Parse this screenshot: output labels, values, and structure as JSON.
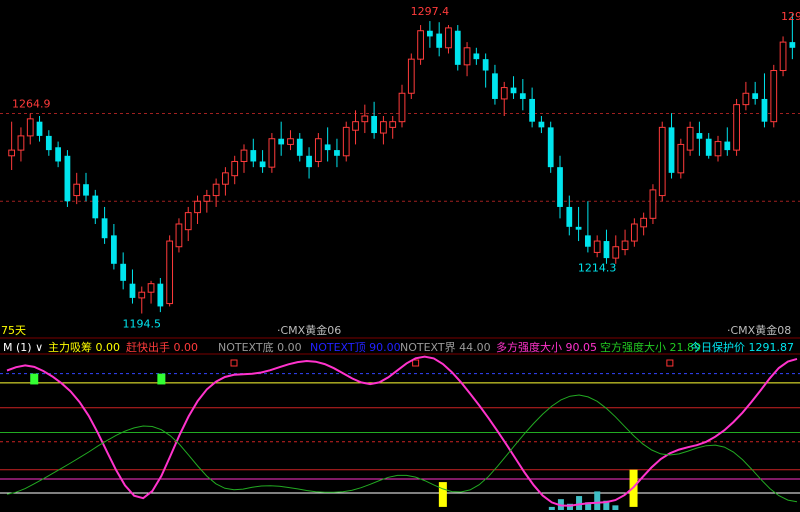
{
  "colors": {
    "background": "#000000",
    "up": "#ff3b3b",
    "down": "#00e5ee",
    "grid_dash": "#a02020",
    "pink": "#ff33cc",
    "green": "#22aa22",
    "yellow": "#ffff00",
    "bright_green": "#33ff33",
    "white": "#ffffff"
  },
  "top_labels": {
    "timeframe": "75天",
    "symbol_mid": "CMX黄金06",
    "symbol_right": "CMX黄金08"
  },
  "price_labels": {
    "high": "1297.4",
    "left_peak": "1264.9",
    "low": "1194.5",
    "mid_low": "1214.3",
    "right_edge": "129"
  },
  "indicator_header": {
    "name": "M (1)",
    "chevron": "∨",
    "items": [
      {
        "label": "主力吸筹",
        "value": "0.00",
        "color": "#ffff00"
      },
      {
        "label": "赶快出手",
        "value": "0.00",
        "color": "#ff3b3b"
      },
      {
        "label": "NOTEXT底",
        "value": "0.00",
        "color": "#999999"
      },
      {
        "label": "NOTEXT顶",
        "value": "90.00",
        "color": "#2222ff"
      },
      {
        "label": "NOTEXT界",
        "value": "44.00",
        "color": "#999999"
      },
      {
        "label": "多方强度大小",
        "value": "90.05",
        "color": "#ff33cc"
      },
      {
        "label": "空方强度大小",
        "value": "21.89",
        "color": "#22cc22"
      },
      {
        "label": "今日保护价",
        "value": "1291.87",
        "color": "#00e5ee"
      }
    ]
  },
  "chart_data": [
    {
      "type": "candlestick",
      "ylim": [
        1188,
        1302
      ],
      "candles": [
        [
          1250,
          1262,
          1245,
          1252
        ],
        [
          1252,
          1260,
          1248,
          1257
        ],
        [
          1257,
          1264.9,
          1254,
          1263
        ],
        [
          1262,
          1264,
          1255,
          1257
        ],
        [
          1257,
          1259,
          1250,
          1252
        ],
        [
          1253,
          1255,
          1246,
          1248
        ],
        [
          1250,
          1252,
          1232,
          1234
        ],
        [
          1236,
          1244,
          1233,
          1240
        ],
        [
          1240,
          1244,
          1234,
          1236
        ],
        [
          1236,
          1238,
          1226,
          1228
        ],
        [
          1228,
          1232,
          1219,
          1221
        ],
        [
          1222,
          1226,
          1210,
          1212
        ],
        [
          1212,
          1216,
          1203,
          1206
        ],
        [
          1205,
          1210,
          1198,
          1200
        ],
        [
          1200,
          1204,
          1194.5,
          1202
        ],
        [
          1202,
          1206,
          1198,
          1205
        ],
        [
          1205,
          1207,
          1195,
          1197
        ],
        [
          1198,
          1222,
          1197,
          1220
        ],
        [
          1218,
          1228,
          1216,
          1226
        ],
        [
          1224,
          1232,
          1220,
          1230
        ],
        [
          1230,
          1236,
          1226,
          1234
        ],
        [
          1234,
          1238,
          1230,
          1236
        ],
        [
          1236,
          1242,
          1232,
          1240
        ],
        [
          1240,
          1246,
          1236,
          1244
        ],
        [
          1243,
          1250,
          1240,
          1248
        ],
        [
          1248,
          1254,
          1244,
          1252
        ],
        [
          1252,
          1256,
          1246,
          1248
        ],
        [
          1248,
          1252,
          1244,
          1246
        ],
        [
          1246,
          1258,
          1244,
          1256
        ],
        [
          1256,
          1262,
          1250,
          1254
        ],
        [
          1254,
          1259,
          1252,
          1256
        ],
        [
          1256,
          1258,
          1248,
          1250
        ],
        [
          1250,
          1253,
          1242,
          1246
        ],
        [
          1248,
          1258,
          1246,
          1256
        ],
        [
          1254,
          1260,
          1248,
          1252
        ],
        [
          1252,
          1256,
          1246,
          1250
        ],
        [
          1250,
          1262,
          1248,
          1260
        ],
        [
          1259,
          1266,
          1254,
          1262
        ],
        [
          1262,
          1268,
          1258,
          1264
        ],
        [
          1264,
          1269,
          1256,
          1258
        ],
        [
          1258,
          1264,
          1254,
          1262
        ],
        [
          1260,
          1264,
          1256,
          1262
        ],
        [
          1262,
          1275,
          1260,
          1272
        ],
        [
          1272,
          1286,
          1270,
          1284
        ],
        [
          1284,
          1296,
          1282,
          1294
        ],
        [
          1294,
          1297.4,
          1288,
          1292
        ],
        [
          1293,
          1297,
          1285,
          1288
        ],
        [
          1288,
          1296,
          1286,
          1295
        ],
        [
          1294,
          1296,
          1280,
          1282
        ],
        [
          1282,
          1290,
          1278,
          1288
        ],
        [
          1286,
          1288,
          1282,
          1284
        ],
        [
          1284,
          1286,
          1274,
          1280
        ],
        [
          1279,
          1282,
          1268,
          1270
        ],
        [
          1270,
          1276,
          1264,
          1274
        ],
        [
          1274,
          1278,
          1270,
          1272
        ],
        [
          1272,
          1277,
          1266,
          1270
        ],
        [
          1270,
          1274,
          1260,
          1262
        ],
        [
          1262,
          1264,
          1258,
          1260
        ],
        [
          1260,
          1262,
          1244,
          1246
        ],
        [
          1246,
          1250,
          1228,
          1232
        ],
        [
          1232,
          1236,
          1222,
          1225
        ],
        [
          1225,
          1232,
          1220,
          1224
        ],
        [
          1222,
          1234,
          1216,
          1218
        ],
        [
          1216,
          1222,
          1214.3,
          1220
        ],
        [
          1220,
          1224,
          1212,
          1214
        ],
        [
          1214,
          1222,
          1212,
          1218
        ],
        [
          1217,
          1224,
          1215,
          1220
        ],
        [
          1220,
          1228,
          1218,
          1226
        ],
        [
          1225,
          1230,
          1222,
          1228
        ],
        [
          1228,
          1240,
          1226,
          1238
        ],
        [
          1236,
          1262,
          1234,
          1260
        ],
        [
          1260,
          1265,
          1242,
          1244
        ],
        [
          1244,
          1256,
          1242,
          1254
        ],
        [
          1252,
          1262,
          1250,
          1260
        ],
        [
          1258,
          1262,
          1250,
          1256
        ],
        [
          1256,
          1258,
          1249,
          1250
        ],
        [
          1250,
          1257,
          1248,
          1255
        ],
        [
          1255,
          1260,
          1250,
          1252
        ],
        [
          1252,
          1270,
          1250,
          1268
        ],
        [
          1268,
          1276,
          1266,
          1272
        ],
        [
          1272,
          1276,
          1268,
          1270
        ],
        [
          1270,
          1279,
          1260,
          1262
        ],
        [
          1262,
          1282,
          1260,
          1280
        ],
        [
          1280,
          1292,
          1278,
          1290
        ],
        [
          1290,
          1300,
          1284,
          1288
        ]
      ]
    },
    {
      "type": "line",
      "ylim": [
        0,
        100
      ],
      "series": [
        {
          "name": "多方强度大小",
          "values": [
            90.0,
            92.1,
            93.3,
            92.3,
            89.7,
            86.1,
            81.8,
            76.5,
            69.6,
            60.8,
            49.8,
            37.7,
            25.9,
            15.9,
            9.2,
            7.6,
            12.2,
            22.0,
            34.9,
            48.3,
            60.4,
            70.3,
            77.8,
            82.8,
            85.8,
            87.2,
            87.6,
            87.9,
            88.7,
            90.2,
            92.1,
            94.0,
            95.4,
            96.1,
            95.7,
            94.1,
            91.5,
            88.2,
            84.9,
            82.3,
            81.2,
            82.3,
            85.6,
            90.1,
            94.6,
            97.9,
            99.0,
            97.8,
            94.2,
            88.9,
            82.4,
            75.1,
            67.5,
            59.5,
            51.1,
            42.3,
            33.2,
            24.2,
            16.0,
            9.3,
            4.9,
            2.9,
            2.8,
            3.6,
            4.4,
            4.7,
            5.1,
            6.4,
            9.6,
            14.7,
            21.2,
            27.6,
            32.9,
            36.6,
            39.0,
            40.5,
            41.9,
            44.0,
            47.3,
            51.5,
            56.7,
            62.8,
            69.8,
            77.3,
            85.0,
            91.6,
            95.8,
            97.5
          ]
        },
        {
          "name": "空方强度大小",
          "values": [
            10.2,
            11.5,
            13.8,
            16.9,
            20.1,
            23.5,
            26.9,
            30.3,
            33.8,
            37.4,
            41.2,
            44.8,
            48.1,
            50.9,
            53.0,
            54.2,
            53.9,
            51.8,
            47.9,
            42.3,
            35.4,
            28.4,
            21.9,
            16.9,
            14.0,
            13.1,
            13.5,
            14.7,
            15.5,
            15.7,
            15.3,
            14.5,
            13.6,
            12.6,
            11.8,
            11.4,
            11.4,
            11.8,
            12.8,
            14.4,
            16.6,
            19.0,
            21.1,
            22.3,
            22.3,
            21.2,
            19.0,
            16.2,
            13.6,
            11.9,
            11.6,
            13.0,
            16.3,
            21.5,
            28.0,
            35.1,
            42.3,
            49.3,
            55.9,
            61.9,
            67.0,
            71.0,
            73.4,
            74.2,
            73.0,
            70.1,
            65.6,
            60.1,
            54.0,
            48.0,
            42.7,
            38.7,
            36.2,
            35.5,
            36.2,
            38.0,
            40.0,
            41.5,
            41.9,
            40.6,
            37.4,
            32.5,
            26.4,
            19.9,
            13.9,
            9.3,
            6.4,
            5.3
          ]
        }
      ],
      "hlines": [
        88,
        82,
        66,
        50,
        44,
        26,
        20,
        11
      ],
      "bars": [
        {
          "start": 81,
          "end": 88,
          "color": "#33ff33"
        },
        {
          "start": 2,
          "end": 18,
          "color": "#ffff00"
        },
        {
          "start": 81,
          "end": 88,
          "color": "#33ff33"
        },
        {
          "start": 2,
          "end": 26,
          "color": "#ffff00"
        }
      ],
      "histogram": [
        2,
        7,
        4,
        9,
        5,
        12,
        6,
        3
      ],
      "markers": [
        0,
        0,
        0
      ]
    }
  ]
}
